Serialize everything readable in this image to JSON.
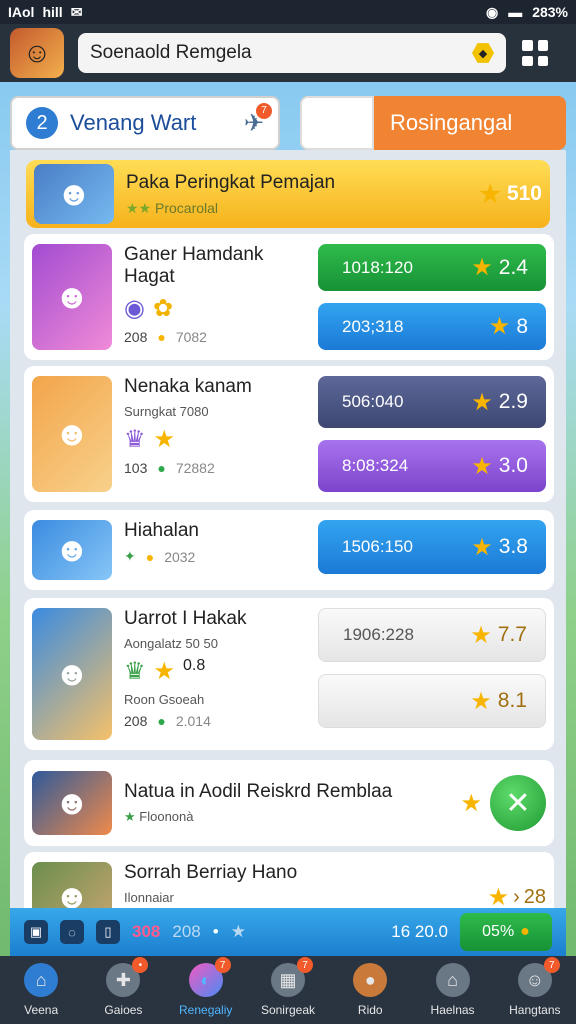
{
  "status": {
    "carrier": "IAol",
    "signal_bars": "hill",
    "battery_pct": "283%"
  },
  "header": {
    "search_text": "Soenaold Remgela"
  },
  "tabs": [
    {
      "number": "2",
      "label": "Venang Wart"
    },
    {
      "label": "Rosingangal"
    }
  ],
  "featured": {
    "title": "Paka Peringkat Pemajan",
    "subtitle": "Procarolal",
    "score": "510"
  },
  "cards": [
    {
      "name": "Ganer Hamdank Hagat",
      "meta_left": "208",
      "meta_right": "7082",
      "buttons": [
        {
          "label": "1018:120",
          "value": "2.4"
        },
        {
          "label": "203;318",
          "value": "8"
        }
      ]
    },
    {
      "name": "Nenaka kanam",
      "sub": "Surngkat 7080",
      "meta_left": "103",
      "meta_right": "72882",
      "buttons": [
        {
          "label": "506:040",
          "value": "2.9"
        },
        {
          "label": "8:08:324",
          "value": "3.0"
        }
      ]
    },
    {
      "name": "Hiahalan",
      "meta_right": "2032",
      "buttons": [
        {
          "label": "1506:150",
          "value": "3.8"
        }
      ]
    },
    {
      "name": "Uarrot I Hakak",
      "sub": "Aongalatz 50 50",
      "extra": "Roon Gsoeah",
      "badge_text": "0.8",
      "meta_left": "208",
      "meta_right": "2.014",
      "buttons": [
        {
          "label": "1906:228",
          "value": "7.7"
        },
        {
          "label": "",
          "value": "8.1"
        }
      ]
    },
    {
      "name": "Natua in Aodil Reiskrd Remblaa",
      "sub": "Floononà"
    },
    {
      "name": "Sorrah Berriay Hano",
      "sub": "Ilonnaiar",
      "score": "28"
    }
  ],
  "footerbar": {
    "pts": "308",
    "pts2": "208",
    "score": "16 20.0",
    "pill": "05%"
  },
  "nav": [
    {
      "label": "Veena",
      "icon": "home-icon"
    },
    {
      "label": "Gaioes",
      "icon": "gamepad-icon"
    },
    {
      "label": "Renegaliy",
      "icon": "ball-icon"
    },
    {
      "label": "Sonirgeak",
      "icon": "box-icon"
    },
    {
      "label": "Rido",
      "icon": "coin-icon"
    },
    {
      "label": "Haelnas",
      "icon": "house-icon"
    },
    {
      "label": "Hangtans",
      "icon": "profile-icon"
    }
  ]
}
